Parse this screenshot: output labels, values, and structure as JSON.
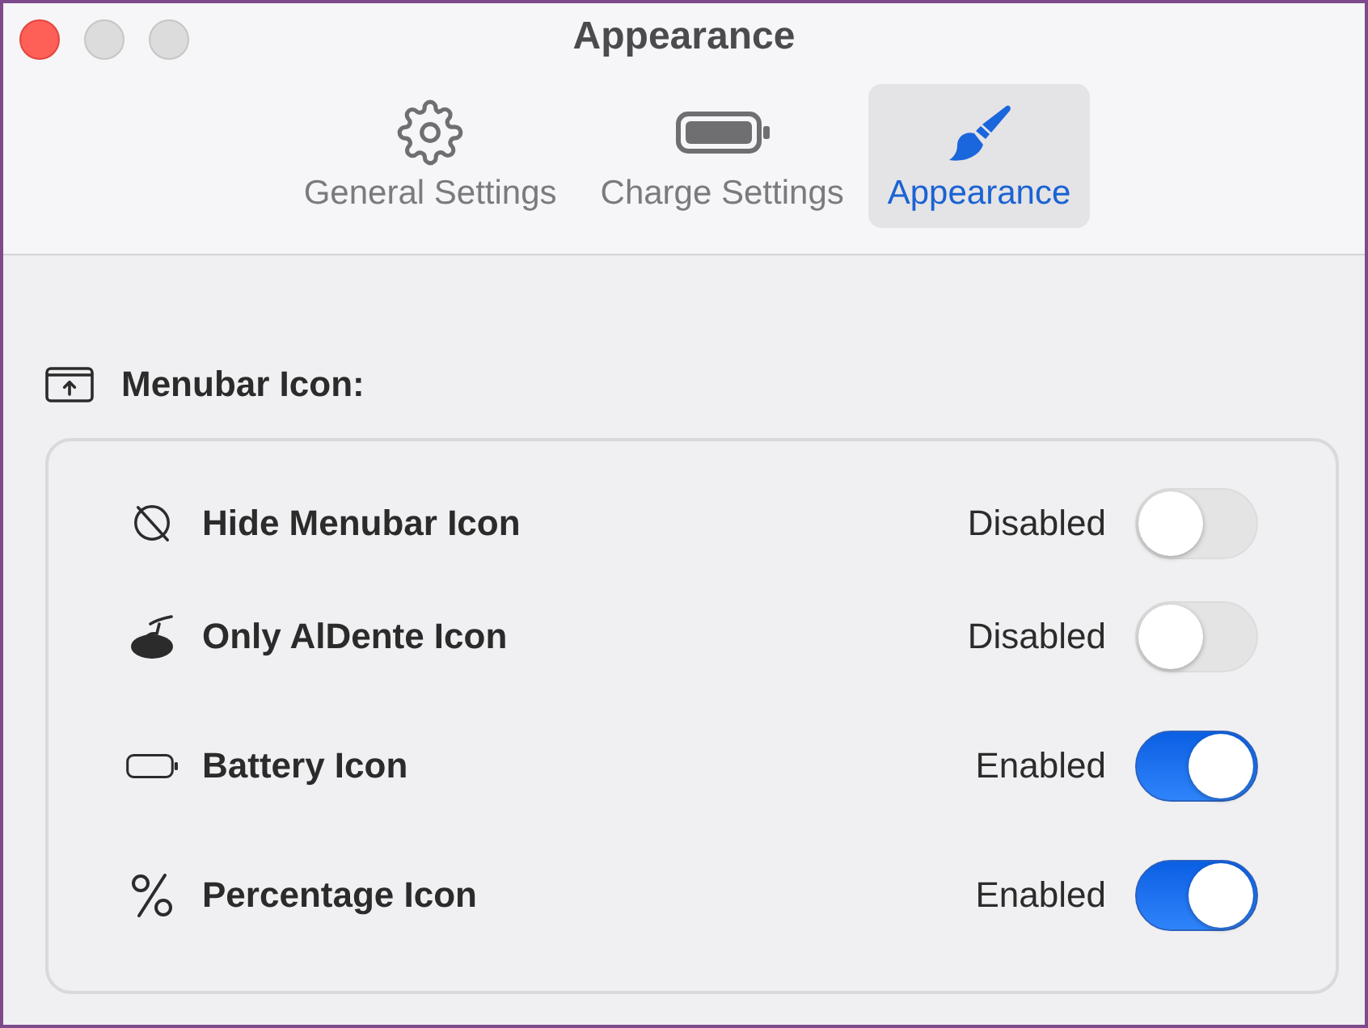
{
  "window": {
    "title": "Appearance"
  },
  "tabs": [
    {
      "label": "General Settings",
      "selected": false
    },
    {
      "label": "Charge Settings",
      "selected": false
    },
    {
      "label": "Appearance",
      "selected": true
    }
  ],
  "section": {
    "heading": "Menubar Icon:",
    "rows": [
      {
        "label": "Hide Menubar Icon",
        "status": "Disabled",
        "on": false
      },
      {
        "label": "Only AlDente Icon",
        "status": "Disabled",
        "on": false
      },
      {
        "label": "Battery Icon",
        "status": "Enabled",
        "on": true
      },
      {
        "label": "Percentage Icon",
        "status": "Enabled",
        "on": true
      }
    ]
  }
}
